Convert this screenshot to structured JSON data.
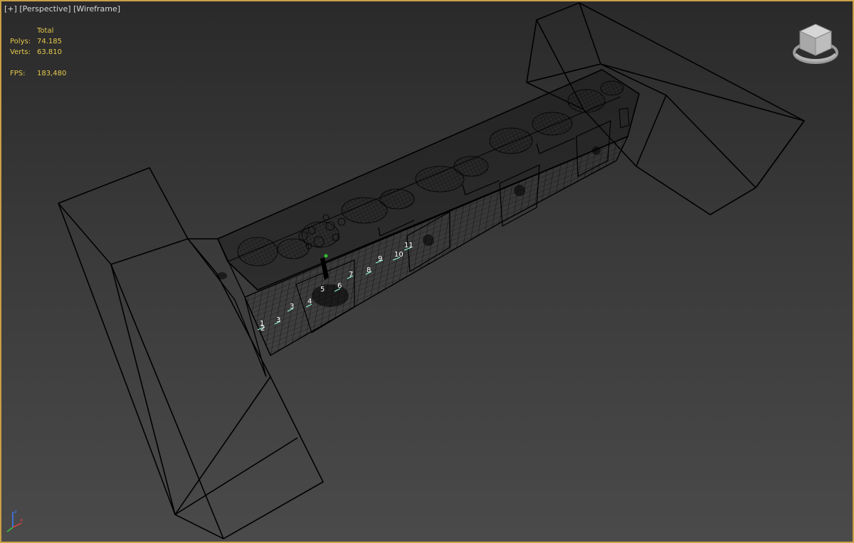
{
  "viewport": {
    "label_parts": [
      "[+]",
      "[Perspective]",
      "[Wireframe]"
    ]
  },
  "stats": {
    "header": "Total",
    "polys_label": "Polys:",
    "polys_value": "74.185",
    "verts_label": "Verts:",
    "verts_value": "63.810",
    "fps_label": "FPS:",
    "fps_value": "183,480"
  },
  "markers": [
    "1",
    "2",
    "3",
    "3",
    "4",
    "5",
    "6",
    "7",
    "8",
    "9",
    "10",
    "11"
  ],
  "icons": {
    "viewcube": "viewcube-icon",
    "axis": "axis-tripod-icon"
  },
  "colors": {
    "border": "#c8a046",
    "stats_text": "#e6c84c",
    "wire": "#000000",
    "marker_text": "#ffffff"
  }
}
